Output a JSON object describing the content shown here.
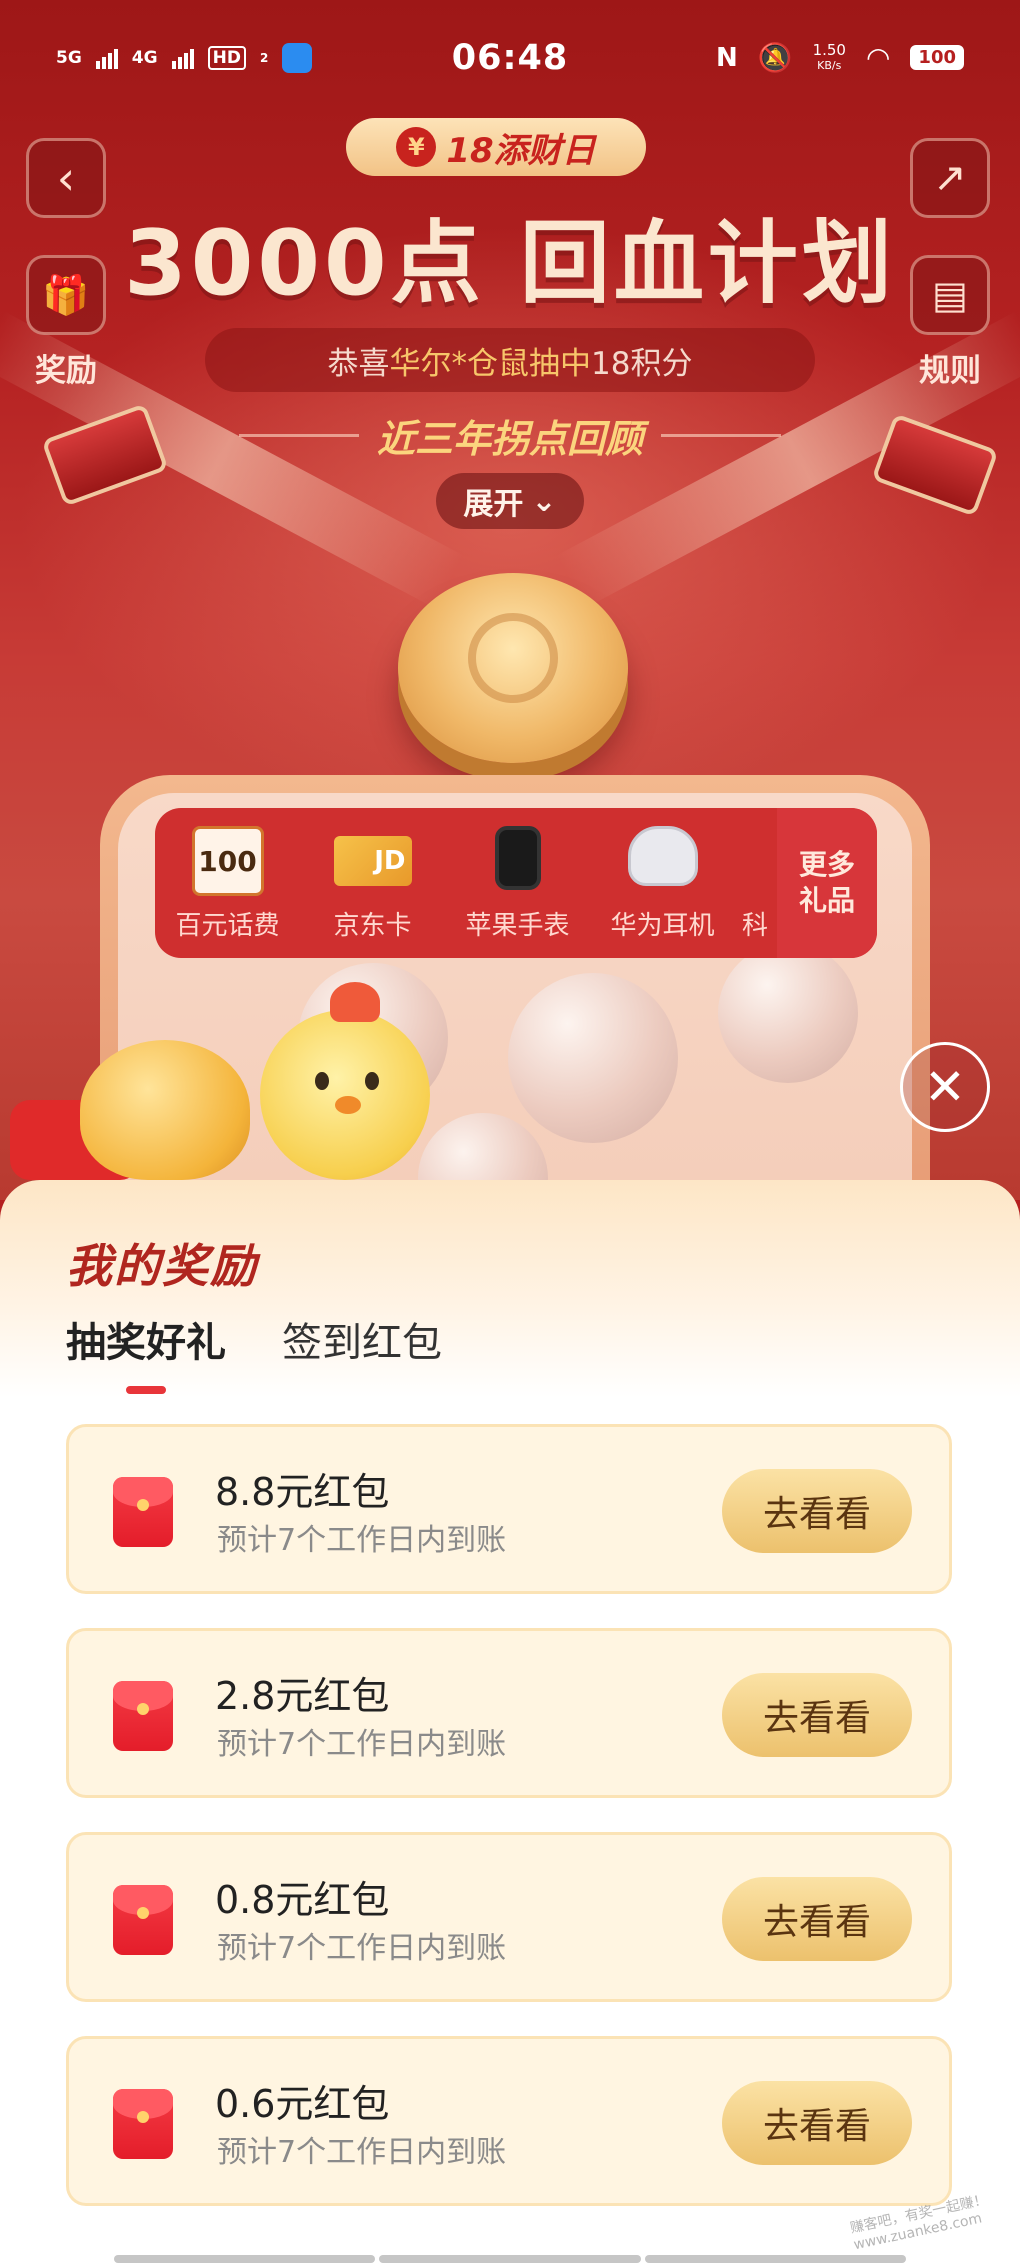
{
  "statusbar": {
    "net1": "5G",
    "net2": "4G",
    "hd": "HD",
    "hd_sub": "2",
    "time": "06:48",
    "nfc": "N",
    "speed_value": "1.50",
    "speed_unit": "KB/s",
    "battery": "100"
  },
  "header": {
    "back_icon": "chevron-left-icon",
    "share_icon": "share-external-icon",
    "rewards_label": "奖励",
    "rules_label": "规则",
    "event_badge": "18添财日",
    "event_badge_icon": "¥",
    "headline": "3000点 回血计划",
    "congrats_prefix": "恭喜",
    "congrats_user": "华尔*仓鼠",
    "congrats_mid": "抽中",
    "congrats_prize": "18积分",
    "review_title": "近三年拐点回顾",
    "expand_label": "展开"
  },
  "prizes": {
    "items": [
      {
        "label": "百元话费",
        "badge": "100"
      },
      {
        "label": "京东卡",
        "badge": "JD"
      },
      {
        "label": "苹果手表"
      },
      {
        "label": "华为耳机"
      },
      {
        "label": "科"
      }
    ],
    "more_label_1": "更多",
    "more_label_2": "礼品"
  },
  "sheet": {
    "title": "我的奖励",
    "tabs": [
      {
        "label": "抽奖好礼",
        "active": true
      },
      {
        "label": "签到红包",
        "active": false
      }
    ],
    "rewards": [
      {
        "title": "8.8元红包",
        "sub": "预计7个工作日内到账",
        "action": "去看看"
      },
      {
        "title": "2.8元红包",
        "sub": "预计7个工作日内到账",
        "action": "去看看"
      },
      {
        "title": "0.8元红包",
        "sub": "预计7个工作日内到账",
        "action": "去看看"
      },
      {
        "title": "0.6元红包",
        "sub": "预计7个工作日内到账",
        "action": "去看看"
      }
    ]
  },
  "watermark": "赚客吧，有奖一起赚！ www.zuanke8.com",
  "colors": {
    "primary_red": "#b51f1f",
    "accent_gold": "#ecc16d",
    "tab_indicator": "#e8353a",
    "card_bg": "#fff5e1"
  }
}
